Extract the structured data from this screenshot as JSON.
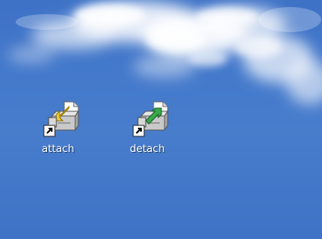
{
  "desktop": {
    "icons": [
      {
        "label": "attach",
        "icon": "attach-shortcut-icon",
        "arrow_color": "#f2d23a"
      },
      {
        "label": "detach",
        "icon": "detach-shortcut-icon",
        "arrow_color": "#3aa84a"
      }
    ]
  },
  "colors": {
    "sky": "#4a80d0",
    "cloud": "#ffffff",
    "label_text": "#ffffff"
  }
}
